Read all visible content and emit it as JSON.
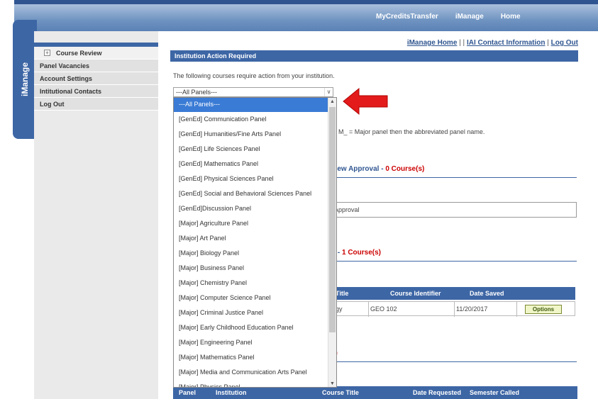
{
  "topnav": {
    "items": [
      "MyCreditsTransfer",
      "iManage",
      "Home"
    ]
  },
  "side_tab": {
    "label": "iManage"
  },
  "sidebar": {
    "items": [
      {
        "label": "Course Review",
        "icon": "plus-box-icon",
        "active": true
      },
      {
        "label": "Panel Vacancies"
      },
      {
        "label": "Account Settings"
      },
      {
        "label": "Intitutional Contacts"
      },
      {
        "label": "Log Out"
      }
    ]
  },
  "toplinks": {
    "home": "iManage Home",
    "sep": "| |",
    "contact": "IAI Contact Information",
    "sep2": "|",
    "logout": "Log Out"
  },
  "main": {
    "section_title": "Institution Action Required",
    "intro": "The following courses require action from your institution.",
    "panel_select": {
      "value": "---All Panels---"
    },
    "legend_tail": "el, M_ = Major panel then the abbreviated panel name.",
    "review_approval": {
      "label": "view Approval - ",
      "count": "0 Course(s)"
    },
    "approval_box": "l Approval",
    "second_section": {
      "label": "n - ",
      "count": "1 Course(s)"
    },
    "table1": {
      "headers": [
        "Title",
        "Course Identifier",
        "Date Saved"
      ],
      "row": {
        "title": "logy",
        "identifier": "GEO 102",
        "date": "11/20/2017",
        "action": "Options"
      }
    },
    "third_section": {
      "label": "s)"
    },
    "table2": {
      "headers": [
        "Panel",
        "Institution",
        "Course Title",
        "Date Requested",
        "Semester Called"
      ]
    }
  },
  "dropdown": {
    "options": [
      "---All Panels---",
      "[GenEd] Communication Panel",
      "[GenEd] Humanities/Fine Arts Panel",
      "[GenEd] Life Sciences Panel",
      "[GenEd] Mathematics Panel",
      "[GenEd] Physical Sciences Panel",
      "[GenEd] Social and Behavioral Sciences Panel",
      "[GenEd]Discussion Panel",
      "[Major] Agriculture Panel",
      "[Major] Art Panel",
      "[Major] Biology Panel",
      "[Major] Business Panel",
      "[Major] Chemistry Panel",
      "[Major] Computer Science Panel",
      "[Major] Criminal Justice Panel",
      "[Major] Early Childhood Education Panel",
      "[Major] Engineering Panel",
      "[Major] Mathematics Panel",
      "[Major] Media and Communication Arts Panel",
      "[Major] Physics Panel"
    ],
    "selected_index": 0
  },
  "colors": {
    "nav_blue": "#3d66a5",
    "selected_blue": "#3a7bd5",
    "arrow_red": "#e31b1b",
    "count_red": "#cc0000"
  }
}
